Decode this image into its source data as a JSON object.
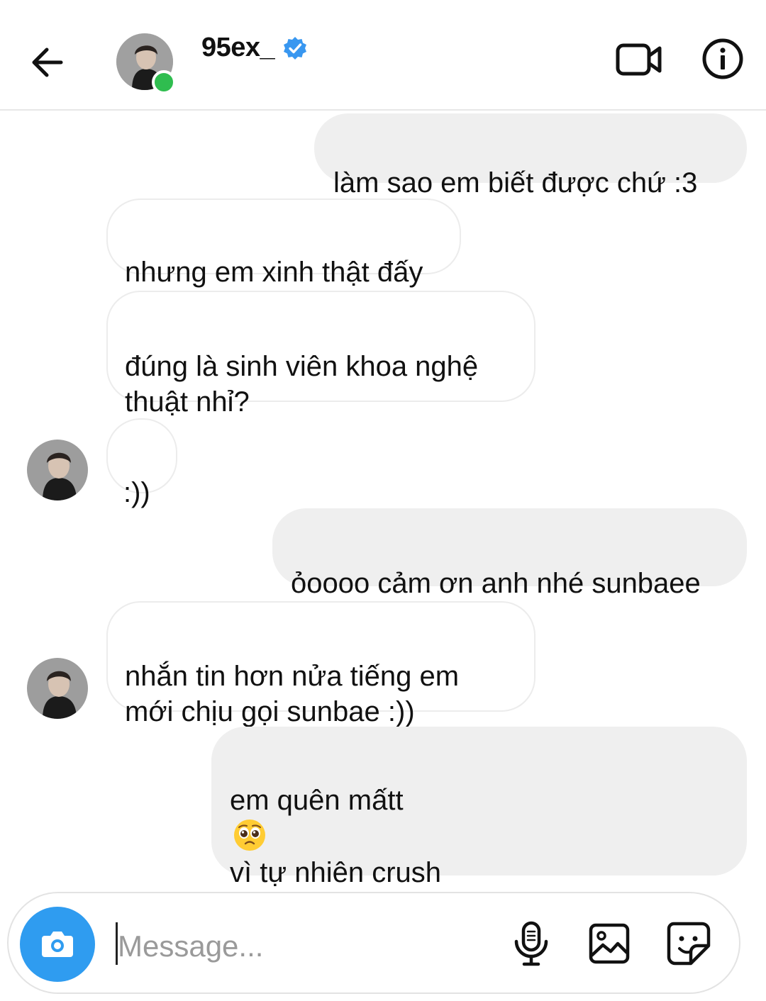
{
  "header": {
    "username": "95ex_",
    "status_online": true,
    "verified": true,
    "icons": {
      "back": "arrow-left-icon",
      "video": "video-camera-icon",
      "info": "info-icon",
      "verified": "verified-badge-icon"
    }
  },
  "messages": [
    {
      "direction": "outgoing",
      "text": "làm sao em biết được chứ :3"
    },
    {
      "direction": "incoming",
      "text": "nhưng em xinh thật đấy"
    },
    {
      "direction": "incoming",
      "text": "đúng là sinh viên khoa nghệ\nthuật nhỉ?"
    },
    {
      "direction": "incoming",
      "text": ":))"
    },
    {
      "direction": "outgoing",
      "text": "ỏoooo cảm ơn anh nhé sunbaee"
    },
    {
      "direction": "incoming",
      "text": "nhắn tin hơn nửa tiếng em\nmới chịu gọi sunbae :))"
    },
    {
      "direction": "outgoing",
      "text_before_emoji": "em quên mấtt",
      "emoji": "pleading-face",
      "text_after_emoji": "vì tự nhiên crush\ncủa em nhắn tin cho em nên mới z\nđóo ;)"
    }
  ],
  "composer": {
    "placeholder": "Message...",
    "value": "",
    "icons": [
      "camera-icon",
      "microphone-icon",
      "gallery-icon",
      "sticker-icon"
    ]
  },
  "colors": {
    "outgoing_bubble": "#efefef",
    "incoming_border": "#ececec",
    "online": "#2fbd4f",
    "camera_button": "#2f9cf0",
    "verified": "#3897f0"
  }
}
